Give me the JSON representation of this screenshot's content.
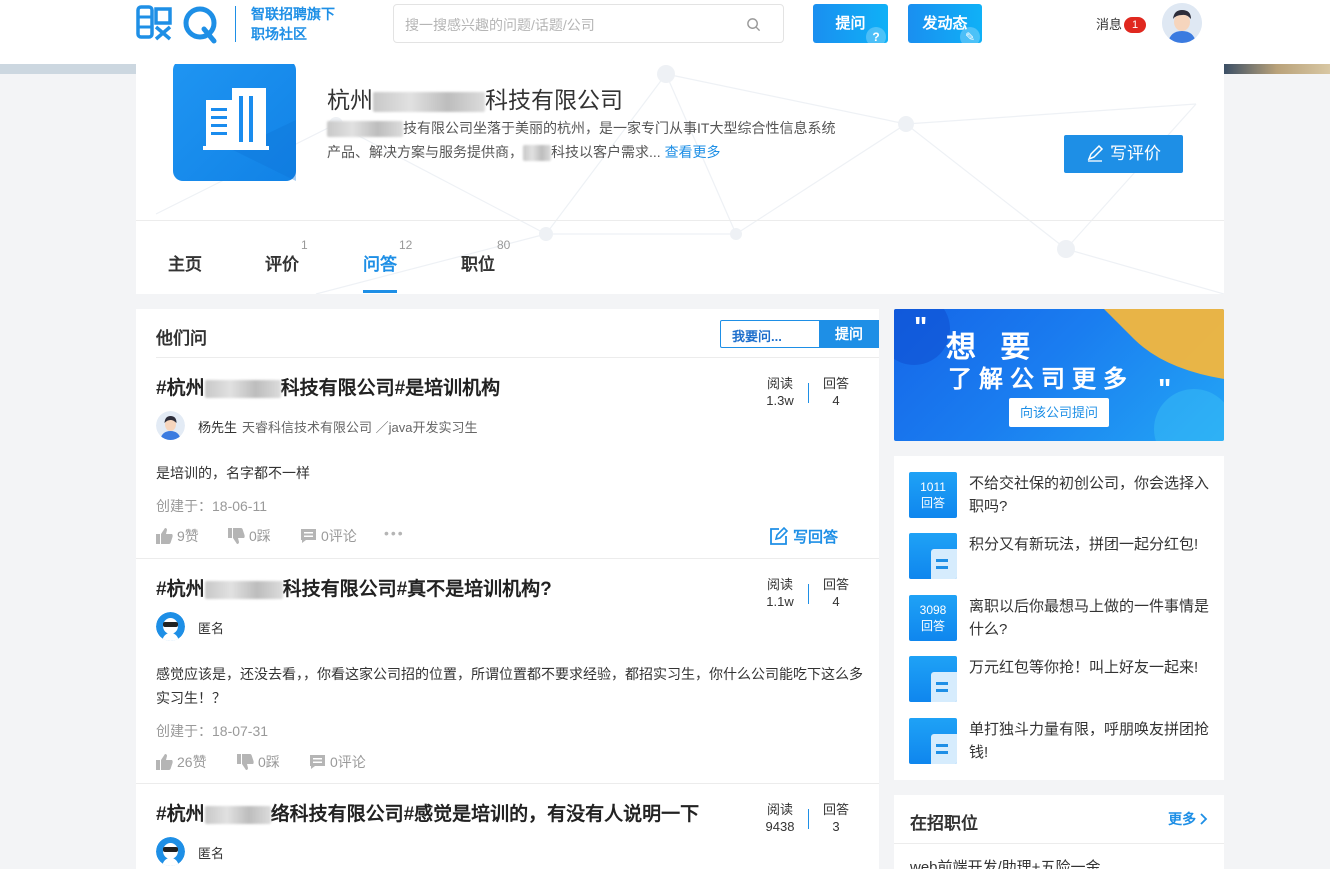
{
  "header": {
    "logo_alt": "职Q",
    "tagline_1": "智联招聘旗下",
    "tagline_2": "职场社区",
    "search_placeholder": "搜一搜感兴趣的问题/话题/公司",
    "ask_button": "提问",
    "post_button": "发动态",
    "messages_label": "消息",
    "messages_count": "1"
  },
  "company": {
    "name_prefix": "杭州",
    "name_suffix": "科技有限公司",
    "desc_line1_suffix": "技有限公司坐落于美丽的杭州，是一家专门从事IT大型综合性信息系统",
    "desc_line2_prefix": "产品、解决方案与服务提供商，",
    "desc_line2_suffix": "科技以客户需求...",
    "view_more": "查看更多",
    "write_review": "写评价",
    "tabs": [
      {
        "label": "主页",
        "count": ""
      },
      {
        "label": "评价",
        "count": "1"
      },
      {
        "label": "问答",
        "count": "12"
      },
      {
        "label": "职位",
        "count": "80"
      }
    ]
  },
  "qa": {
    "section_title": "他们问",
    "ask_input_placeholder": "我要问...",
    "ask_button": "提问",
    "read_label": "阅读",
    "answer_label": "回答",
    "write_answer": "写回答",
    "questions": [
      {
        "title_prefix": "#杭州",
        "title_suffix": "科技有限公司#是培训机构",
        "reads": "1.3w",
        "answers": "4",
        "user": "杨先生",
        "user_info": "天睿科信技术有限公司 ／java开发实习生",
        "body": "是培训的，名字都不一样",
        "created": "创建于：18-06-11",
        "likes": "9赞",
        "dislikes": "0踩",
        "comments": "0评论"
      },
      {
        "title_prefix": "#杭州",
        "title_suffix": "科技有限公司#真不是培训机构?",
        "reads": "1.1w",
        "answers": "4",
        "user": "匿名",
        "user_info": "",
        "body": "感觉应该是，还没去看，，你看这家公司招的位置，所谓位置都不要求经验，都招实习生，你什么公司能吃下这么多实习生！？",
        "created": "创建于：18-07-31",
        "likes": "26赞",
        "dislikes": "0踩",
        "comments": "0评论"
      },
      {
        "title_prefix": "#杭州",
        "title_suffix": "络科技有限公司#感觉是培训的，有没有人说明一下",
        "reads": "9438",
        "answers": "3",
        "user": "匿名",
        "user_info": ""
      }
    ]
  },
  "promo": {
    "line1": "想 要",
    "line2": "了解公司更多",
    "button": "向该公司提问"
  },
  "topics": [
    {
      "count": "1011",
      "count_label": "回答",
      "text": "不给交社保的初创公司，你会选择入职吗?"
    },
    {
      "count": "",
      "count_label": "",
      "text": "积分又有新玩法，拼团一起分红包!"
    },
    {
      "count": "3098",
      "count_label": "回答",
      "text": "离职以后你最想马上做的一件事情是什么?"
    },
    {
      "count": "",
      "count_label": "",
      "text": "万元红包等你抢！叫上好友一起来!"
    },
    {
      "count": "",
      "count_label": "",
      "text": "单打独斗力量有限，呼朋唤友拼团抢钱!"
    }
  ],
  "jobs": {
    "title": "在招职位",
    "more": "更多",
    "first_item": "web前端开发/助理+五险一金"
  }
}
